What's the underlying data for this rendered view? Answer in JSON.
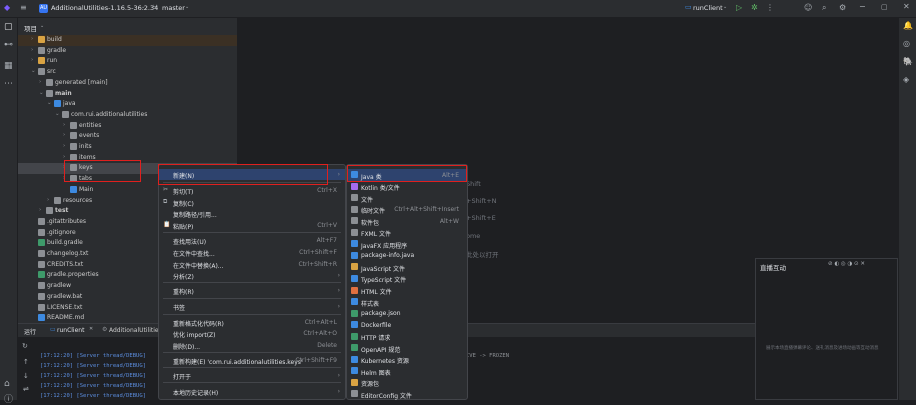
{
  "topbar": {
    "project_badge": "AU",
    "project_name": "AdditionalUtilities-1.16.5-36.2.34",
    "branch": "master",
    "run_config": "runClient"
  },
  "left_tools": {
    "project": "▢",
    "commit": "⊷",
    "structure": "▦",
    "more": "⋯",
    "terminal": "⌂",
    "problems": "ⓘ"
  },
  "right_tools": {
    "notifications": "🔔",
    "ai": "◎",
    "gradle": "🐘",
    "db": "◈"
  },
  "project_panel": {
    "title": "项目",
    "rows": [
      {
        "arrow": "›",
        "label": "build",
        "color": "#d9a343",
        "excluded": true
      },
      {
        "arrow": "›",
        "label": "gradle",
        "color": "#8c8f94"
      },
      {
        "arrow": "›",
        "label": "run",
        "color": "#d9a343"
      },
      {
        "arrow": "⌄",
        "label": "src",
        "color": "#8c8f94"
      },
      {
        "arrow": "›",
        "label": "generated [main]",
        "color": "#8c8f94"
      },
      {
        "arrow": "⌄",
        "label": "main",
        "color": "#8c8f94"
      },
      {
        "arrow": "⌄",
        "label": "java",
        "color": "#3d8ae0"
      },
      {
        "arrow": "⌄",
        "label": "com.rui.additionalutilities",
        "color": "#8c8f94"
      },
      {
        "arrow": "›",
        "label": "entities",
        "color": "#8c8f94"
      },
      {
        "arrow": "›",
        "label": "events",
        "color": "#8c8f94"
      },
      {
        "arrow": "›",
        "label": "inits",
        "color": "#8c8f94"
      },
      {
        "arrow": "›",
        "label": "items",
        "color": "#8c8f94"
      },
      {
        "arrow": "›",
        "label": "keys",
        "color": "#8c8f94",
        "selected": true
      },
      {
        "arrow": "›",
        "label": "tabs",
        "color": "#8c8f94"
      },
      {
        "arrow": "",
        "label": "Main",
        "color": "#3d8ae0"
      },
      {
        "arrow": "›",
        "label": "resources",
        "color": "#8c8f94"
      },
      {
        "arrow": "›",
        "label": "test",
        "color": "#8c8f94"
      },
      {
        "arrow": "",
        "label": ".gitattributes",
        "color": "#8c8f94"
      },
      {
        "arrow": "",
        "label": ".gitignore",
        "color": "#8c8f94"
      },
      {
        "arrow": "",
        "label": "build.gradle",
        "color": "#3e9a6a"
      },
      {
        "arrow": "",
        "label": "changelog.txt",
        "color": "#8c8f94"
      },
      {
        "arrow": "",
        "label": "CREDITS.txt",
        "color": "#8c8f94"
      },
      {
        "arrow": "",
        "label": "gradle.properties",
        "color": "#3e9a6a"
      },
      {
        "arrow": "",
        "label": "gradlew",
        "color": "#8c8f94"
      },
      {
        "arrow": "",
        "label": "gradlew.bat",
        "color": "#8c8f94"
      },
      {
        "arrow": "",
        "label": "LICENSE.txt",
        "color": "#8c8f94"
      },
      {
        "arrow": "",
        "label": "README.md",
        "color": "#3d8ae0"
      }
    ]
  },
  "editor_hints": [
    {
      "text": "Shift"
    },
    {
      "text": "+Shift+N"
    },
    {
      "text": "+Shift+E"
    },
    {
      "text": "+E"
    },
    {
      "text": "ome"
    },
    {
      "text": "此处以打开"
    }
  ],
  "run_panel": {
    "tab_run": "运行",
    "tab_runclient": "runClient",
    "tab_additional": "AdditionalUtilities",
    "logs": [
      "[17:12:20] [Server thread/DEBUG]",
      "[17:12:20] [Server thread/DEBUG]",
      "[17:12:20] [Server thread/DEBUG]",
      "[17:12:20] [Server thread/DEBUG]",
      "[17:12:20] [Server thread/DEBUG]"
    ],
    "log_tail": "IVE -> FROZEN"
  },
  "context_menu": {
    "items": [
      {
        "label": "新建(N)",
        "shortcut": "",
        "sub": true,
        "highlight": true
      },
      {
        "label": "剪切(T)",
        "shortcut": "Ctrl+X"
      },
      {
        "label": "复制(C)",
        "shortcut": ""
      },
      {
        "label": "复制路径/引用...",
        "shortcut": ""
      },
      {
        "label": "粘贴(P)",
        "shortcut": "Ctrl+V"
      },
      {
        "label": "查找用法(U)",
        "shortcut": "Alt+F7"
      },
      {
        "label": "在文件中查找...",
        "shortcut": "Ctrl+Shift+F"
      },
      {
        "label": "在文件中替换(A)...",
        "shortcut": "Ctrl+Shift+R"
      },
      {
        "label": "分析(Z)",
        "shortcut": "",
        "sub": true
      },
      {
        "label": "重构(R)",
        "shortcut": "",
        "sub": true
      },
      {
        "label": "书签",
        "shortcut": "",
        "sub": true
      },
      {
        "label": "重新格式化代码(R)",
        "shortcut": "Ctrl+Alt+L"
      },
      {
        "label": "优化 import(Z)",
        "shortcut": "Ctrl+Alt+O"
      },
      {
        "label": "删除(D)...",
        "shortcut": "Delete"
      },
      {
        "label": "重新构建(E) 'com.rui.additionalutilities.keys'",
        "shortcut": "Ctrl+Shift+F9"
      },
      {
        "label": "打开于",
        "shortcut": "",
        "sub": true
      },
      {
        "label": "本地历史记录(H)",
        "shortcut": "",
        "sub": true
      }
    ]
  },
  "new_submenu": {
    "items": [
      {
        "label": "Java 类",
        "shortcut": "Alt+E",
        "color": "#3d8ae0",
        "highlight": true
      },
      {
        "label": "Kotlin 类/文件",
        "shortcut": "",
        "color": "#a66cf0"
      },
      {
        "label": "文件",
        "shortcut": "",
        "color": "#8c8f94"
      },
      {
        "label": "临时文件",
        "shortcut": "Ctrl+Alt+Shift+Insert",
        "color": "#8c8f94"
      },
      {
        "label": "软件包",
        "shortcut": "Alt+W",
        "color": "#8c8f94"
      },
      {
        "label": "FXML 文件",
        "shortcut": "",
        "color": "#8c8f94"
      },
      {
        "label": "JavaFX 应用程序",
        "shortcut": "",
        "color": "#3d8ae0"
      },
      {
        "label": "package-info.java",
        "shortcut": "",
        "color": "#3d8ae0"
      },
      {
        "label": "JavaScript 文件",
        "shortcut": "",
        "color": "#d9a343"
      },
      {
        "label": "TypeScript 文件",
        "shortcut": "",
        "color": "#3d8ae0"
      },
      {
        "label": "HTML 文件",
        "shortcut": "",
        "color": "#e07040"
      },
      {
        "label": "样式表",
        "shortcut": "",
        "color": "#3d8ae0"
      },
      {
        "label": "package.json",
        "shortcut": "",
        "color": "#3e9a6a"
      },
      {
        "label": "Dockerfile",
        "shortcut": "",
        "color": "#3d8ae0"
      },
      {
        "label": "HTTP 请求",
        "shortcut": "",
        "color": "#3e9a6a"
      },
      {
        "label": "OpenAPI 规范",
        "shortcut": "",
        "color": "#3e9a6a"
      },
      {
        "label": "Kubernetes 资源",
        "shortcut": "",
        "color": "#3d8ae0"
      },
      {
        "label": "Helm 图表",
        "shortcut": "",
        "color": "#3d8ae0"
      },
      {
        "label": "资源包",
        "shortcut": "",
        "color": "#d9a343"
      },
      {
        "label": "EditorConfig 文件",
        "shortcut": "",
        "color": "#8c8f94"
      }
    ]
  },
  "live_panel": {
    "title": "直播互动",
    "hint": "展示本场直播弹幕评论、送礼消息及进场动画等互动消息"
  }
}
